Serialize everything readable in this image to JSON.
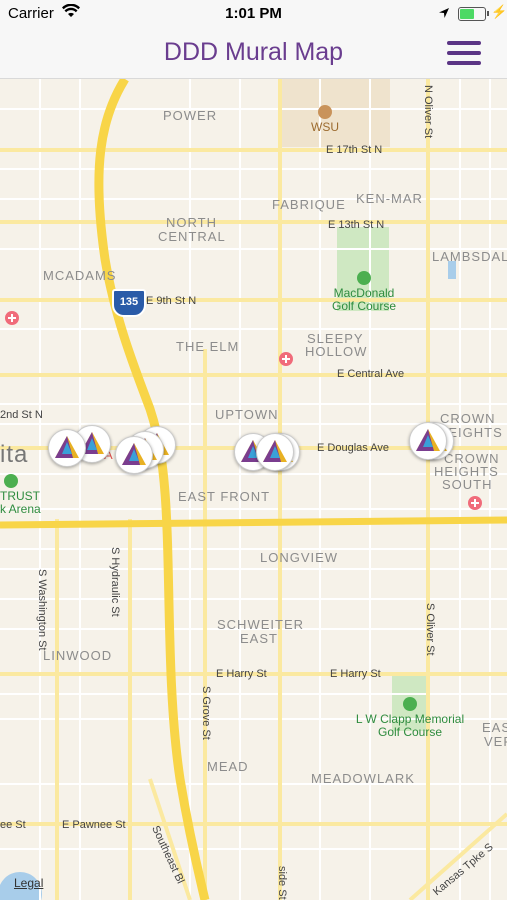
{
  "status": {
    "carrier": "Carrier",
    "time": "1:01 PM"
  },
  "nav": {
    "title": "DDD Mural Map"
  },
  "neighborhoods": {
    "power": "POWER",
    "fabrique": "FABRIQUE",
    "kenmar": "KEN-MAR",
    "north_central_1": "NORTH",
    "north_central_2": "CENTRAL",
    "lambsdale": "LAMBSDAL",
    "mcadams": "MCADAMS",
    "the_elm": "THE ELM",
    "sleepy_1": "SLEEPY",
    "sleepy_2": "HOLLOW",
    "uptown": "UPTOWN",
    "crown_heights_1": "CROWN",
    "crown_heights_2": "HEIGHTS",
    "crown_heights_south_1": "CROWN",
    "crown_heights_south_2": "HEIGHTS",
    "crown_heights_south_3": "SOUTH",
    "east_front": "EAST FRONT",
    "longview": "LONGVIEW",
    "schweiter_1": "SCHWEITER",
    "schweiter_2": "EAST",
    "linwood": "LINWOOD",
    "mead": "MEAD",
    "meadowlark": "MEADOWLARK",
    "eas_1": "EAS",
    "eas_2": "VER",
    "ita": "ita",
    "a": "A"
  },
  "streets": {
    "e17th": "E 17th St N",
    "e13th": "E 13th St N",
    "e9th": "E 9th St N",
    "central": "E Central Ave",
    "douglas": "E Douglas Ave",
    "second": "2nd St N",
    "harry1": "E Harry St",
    "harry2": "E Harry St",
    "pawnee": "E Pawnee St",
    "pawnee_left": "ee St",
    "washington": "S Washington St",
    "hydraulic": "S Hydraulic St",
    "grove": "S Grove St",
    "oliver": "S Oliver St",
    "n_oliver": "N Oliver St",
    "southeast": "Southeast Bl",
    "kansas": "Kansas Tpke S",
    "hillside": "side St"
  },
  "places": {
    "wsu": "WSU",
    "macdonald_1": "MacDonald",
    "macdonald_2": "Golf Course",
    "clapp_1": "L W Clapp Memorial",
    "clapp_2": "Golf Course",
    "arena_1": "TRUST",
    "arena_2": "k Arena"
  },
  "highway": {
    "shield": "135"
  },
  "legal": "Legal"
}
